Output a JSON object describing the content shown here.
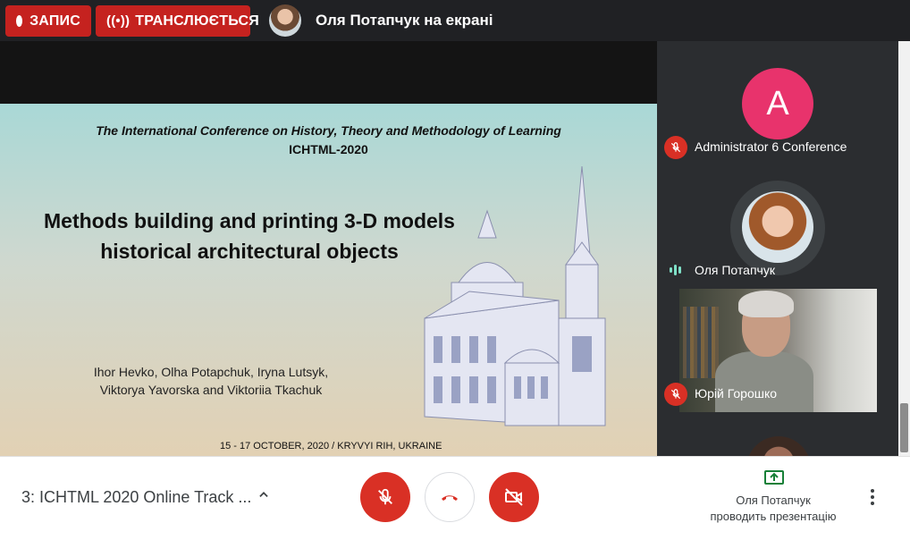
{
  "topbar": {
    "record_label": "ЗАПИС",
    "live_label": "ТРАНСЛЮЄТЬСЯ",
    "presenter_text": "Оля Потапчук на екрані"
  },
  "slide": {
    "conference_title": "The International Conference on History, Theory and Methodology of Learning",
    "conference_short": "ICHTML-2020",
    "title_line1": "Methods building and printing 3-D models",
    "title_line2": "historical architectural objects",
    "authors_line1": "Ihor Hevko, Olha Potapchuk, Iryna Lutsyk,",
    "authors_line2": "Viktorya Yavorska and Viktoriia Tkachuk",
    "dates": "15 - 17 OCTOBER, 2020 / KRYVYI RIH, UKRAINE"
  },
  "participants": [
    {
      "avatar_letter": "A",
      "name": "Administrator 6 Conference",
      "muted": true,
      "avatar_color": "#e8336c"
    },
    {
      "name": "Оля Потапчук",
      "speaking": true
    },
    {
      "name": "Юрій Горошко",
      "muted": true,
      "video": true
    }
  ],
  "bottombar": {
    "meeting_title": "3: ICHTML 2020 Online Track ...",
    "presenter_name": "Оля Потапчук",
    "presenter_status": "проводить презентацію"
  },
  "colors": {
    "danger": "#d93025",
    "recording": "#c5221f",
    "avatar_pink": "#e8336c",
    "speaking": "#7fe0c7"
  },
  "icons": [
    "record-dot-icon",
    "broadcast-icon",
    "mic-off-icon",
    "hangup-icon",
    "camera-off-icon",
    "present-icon",
    "more-vert-icon",
    "chevron-up-icon",
    "speaking-indicator-icon"
  ]
}
